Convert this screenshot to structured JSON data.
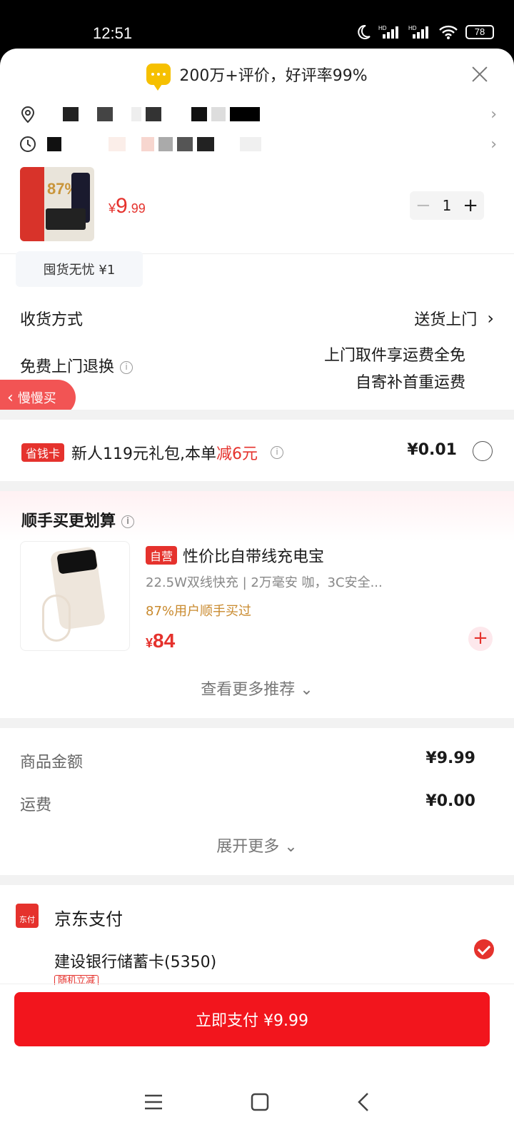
{
  "status": {
    "time": "12:51",
    "battery": "78"
  },
  "banner": {
    "text": "200万+评价，好评率99%"
  },
  "product": {
    "price_symbol": "¥",
    "price_int": "9",
    "price_dec": ".99",
    "quantity": "1",
    "thumb_pct": "87%"
  },
  "service_chip": "囤货无忧 ¥1",
  "delivery": {
    "label": "收货方式",
    "value": "送货上门"
  },
  "return": {
    "label": "免费上门退换",
    "line1": "上门取件享运费全免",
    "line2": "自寄补首重运费"
  },
  "slow_buy": "慢慢买",
  "saver": {
    "tag": "省钱卡",
    "text": "新人119元礼包,本单",
    "highlight": "减6元",
    "price": "¥0.01"
  },
  "reco": {
    "title": "顺手买更划算",
    "tag": "自营",
    "name": "性价比自带线充电宝",
    "desc": "22.5W双线快充 | 2万毫安 咖，3C安全...",
    "social": "87%用户顺手买过",
    "price_symbol": "¥",
    "price": "84",
    "more": "查看更多推荐"
  },
  "summary": {
    "goods_label": "商品金额",
    "goods_value": "¥9.99",
    "ship_label": "运费",
    "ship_value": "¥0.00",
    "expand": "展开更多"
  },
  "payment": {
    "icon_text": "东付",
    "title": "京东支付",
    "card": "建设银行储蓄卡(5350)",
    "sub": "随机立减"
  },
  "pay_button": "立即支付 ¥9.99"
}
